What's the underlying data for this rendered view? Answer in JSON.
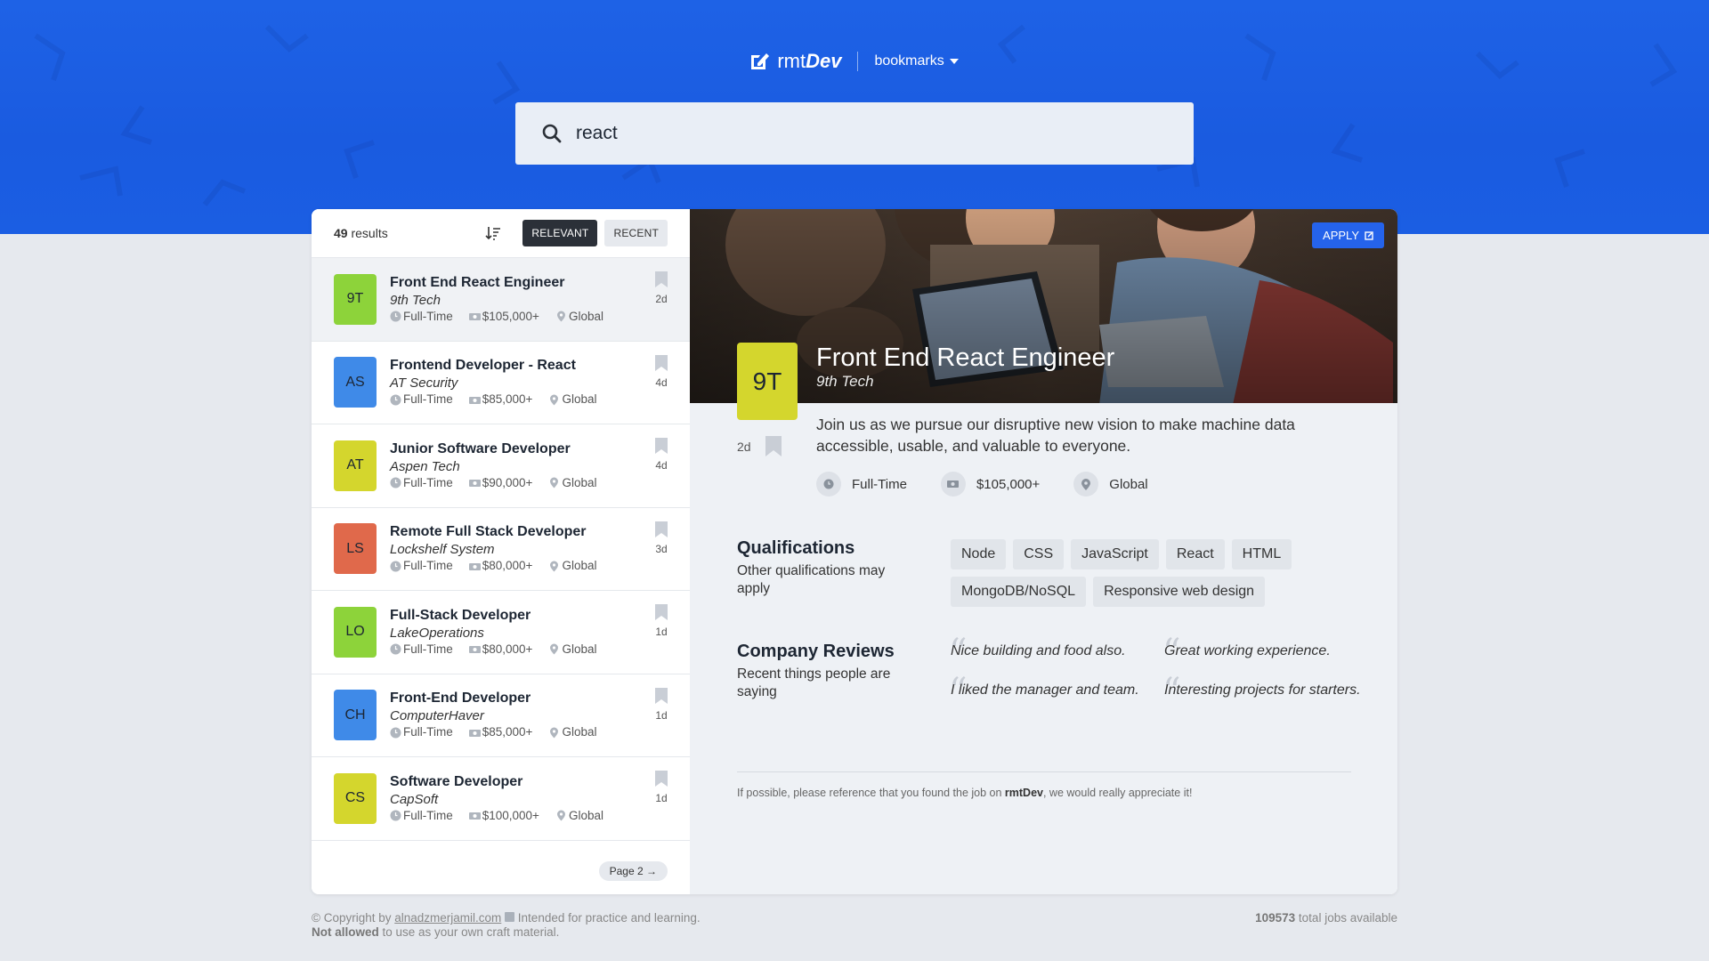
{
  "header": {
    "logo_light": "rmt",
    "logo_bold": "Dev",
    "bookmarks_label": "bookmarks"
  },
  "search": {
    "value": "react",
    "placeholder": ""
  },
  "results": {
    "count": "49",
    "count_suffix": " results",
    "sort_relevant": "RELEVANT",
    "sort_recent": "RECENT"
  },
  "jobs": [
    {
      "badge": "9T",
      "badge_color": "#8dd33a",
      "title": "Front End React Engineer",
      "company": "9th Tech",
      "type": "Full-Time",
      "salary": "$105,000+",
      "location": "Global",
      "days": "2d",
      "selected": true
    },
    {
      "badge": "AS",
      "badge_color": "#3f8ae8",
      "title": "Frontend Developer - React",
      "company": "AT Security",
      "type": "Full-Time",
      "salary": "$85,000+",
      "location": "Global",
      "days": "4d",
      "selected": false
    },
    {
      "badge": "AT",
      "badge_color": "#d4d62d",
      "title": "Junior Software Developer",
      "company": "Aspen Tech",
      "type": "Full-Time",
      "salary": "$90,000+",
      "location": "Global",
      "days": "4d",
      "selected": false
    },
    {
      "badge": "LS",
      "badge_color": "#e0694b",
      "title": "Remote Full Stack Developer",
      "company": "Lockshelf System",
      "type": "Full-Time",
      "salary": "$80,000+",
      "location": "Global",
      "days": "3d",
      "selected": false
    },
    {
      "badge": "LO",
      "badge_color": "#8dd33a",
      "title": "Full-Stack Developer",
      "company": "LakeOperations",
      "type": "Full-Time",
      "salary": "$80,000+",
      "location": "Global",
      "days": "1d",
      "selected": false
    },
    {
      "badge": "CH",
      "badge_color": "#3f8ae8",
      "title": "Front-End Developer",
      "company": "ComputerHaver",
      "type": "Full-Time",
      "salary": "$85,000+",
      "location": "Global",
      "days": "1d",
      "selected": false
    },
    {
      "badge": "CS",
      "badge_color": "#d4d62d",
      "title": "Software Developer",
      "company": "CapSoft",
      "type": "Full-Time",
      "salary": "$100,000+",
      "location": "Global",
      "days": "1d",
      "selected": false
    }
  ],
  "pager": {
    "label": "Page 2"
  },
  "detail": {
    "apply_label": "APPLY",
    "badge": "9T",
    "title": "Front End React Engineer",
    "company": "9th Tech",
    "days": "2d",
    "description": "Join us as we pursue our disruptive new vision to make machine data accessible, usable, and valuable to everyone.",
    "type": "Full-Time",
    "salary": "$105,000+",
    "location": "Global",
    "qualifications_title": "Qualifications",
    "qualifications_sub": "Other qualifications may apply",
    "qualifications": [
      "Node",
      "CSS",
      "JavaScript",
      "React",
      "HTML",
      "MongoDB/NoSQL",
      "Responsive web design"
    ],
    "reviews_title": "Company Reviews",
    "reviews_sub": "Recent things people are saying",
    "reviews": [
      "Nice building and food also.",
      "Great working experience.",
      "I liked the manager and team.",
      "Interesting projects for starters."
    ],
    "footnote_pre": "If possible, please reference that you found the job on ",
    "footnote_brand": "rmtDev",
    "footnote_post": ", we would really appreciate it!"
  },
  "footer": {
    "copyright_pre": "© Copyright by ",
    "copyright_link": "alnadzmerjamil.com",
    "copyright_post": " Intended for practice and learning.",
    "not_allowed": "Not allowed",
    "not_allowed_post": " to use as your own craft material.",
    "total_jobs": "109573",
    "total_jobs_suffix": " total jobs available"
  },
  "colors": {
    "accent": "#1e62e6",
    "apply": "#2563eb",
    "dark_button": "#2b3038"
  }
}
